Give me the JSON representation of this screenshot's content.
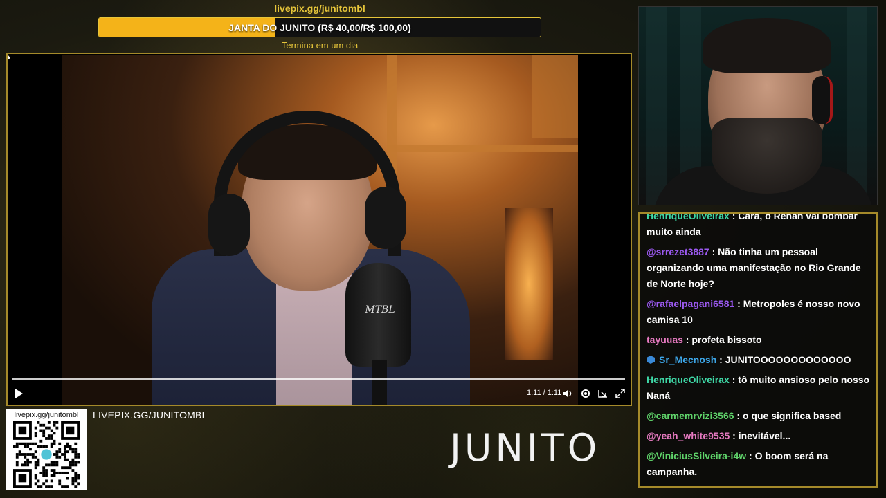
{
  "goal": {
    "url": "livepix.gg/junitombl",
    "label": "JANTA DO JUNITO (R$ 40,00/R$ 100,00)",
    "progress_fraction": 0.4,
    "ends": "Termina em um dia",
    "bar_color": "#f4b319",
    "accent_color": "#e6c53a"
  },
  "video": {
    "mic_logo": "MTBL",
    "progress_fraction": 1.0,
    "time": "1:11 / 1:11",
    "icons": [
      "play-icon",
      "volume-icon",
      "settings-icon",
      "miniplayer-icon",
      "fullscreen-icon"
    ]
  },
  "chat": {
    "messages": [
      {
        "user": "HenriqueOliveirax",
        "color": "#3fd9a7",
        "text": "Cara, o Renan vai bombar muito ainda"
      },
      {
        "user": "@srrezet3887",
        "color": "#9b59f0",
        "text": "Não tinha um pessoal organizando uma manifestação no Rio Grande de Norte hoje?"
      },
      {
        "user": "@rafaelpagani6581",
        "color": "#9b59f0",
        "text": "Metropoles é nosso novo camisa 10"
      },
      {
        "user": "tayuuas",
        "color": "#e67ac0",
        "text": "profeta bissoto"
      },
      {
        "user": "Sr_Mecnosh",
        "color": "#3da6e8",
        "text": "JUNITOOOOOOOOOOOOO",
        "badge": "sub-badge-icon"
      },
      {
        "user": "HenriqueOliveirax",
        "color": "#3fd9a7",
        "text": "tô muito ansioso pelo nosso Naná"
      },
      {
        "user": "@carmemrvizi3566",
        "color": "#5fd36a",
        "text": "o que significa based"
      },
      {
        "user": "@yeah_white9535",
        "color": "#e67ac0",
        "text": "inevitável..."
      },
      {
        "user": "@ViniciusSilveira-i4w",
        "color": "#5fd36a",
        "text": "O boom será na campanha."
      }
    ]
  },
  "qr": {
    "label": "livepix.gg/junitombl"
  },
  "bottom": {
    "livepix": "LIVEPIX.GG/JUNITOMBL",
    "brand": "JUNITO"
  }
}
